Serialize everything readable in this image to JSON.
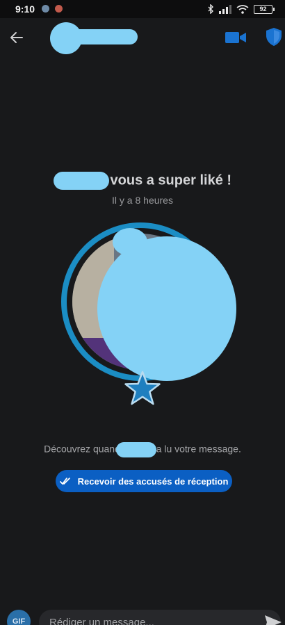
{
  "status_bar": {
    "time": "9:10",
    "battery": "92"
  },
  "header": {
    "back_icon": "arrow-left-icon",
    "video_icon": "video-camera-icon",
    "safety_icon": "shield-icon"
  },
  "match": {
    "super_like_text": "vous a super liké !",
    "time_ago": "Il y a 8 heures",
    "star_icon": "star-icon",
    "discover_before": "Découvrez quand",
    "discover_after": "a lu votre message."
  },
  "receipts_button": {
    "label": "Recevoir des accusés de réception",
    "icon": "double-check-icon"
  },
  "composer": {
    "gif_label": "GIF",
    "placeholder": "Rédiger un message..."
  },
  "colors": {
    "background": "#18191b",
    "accent_blue": "#1b8dc4",
    "button_blue": "#0b5fc3",
    "redaction": "#84d2f6"
  }
}
